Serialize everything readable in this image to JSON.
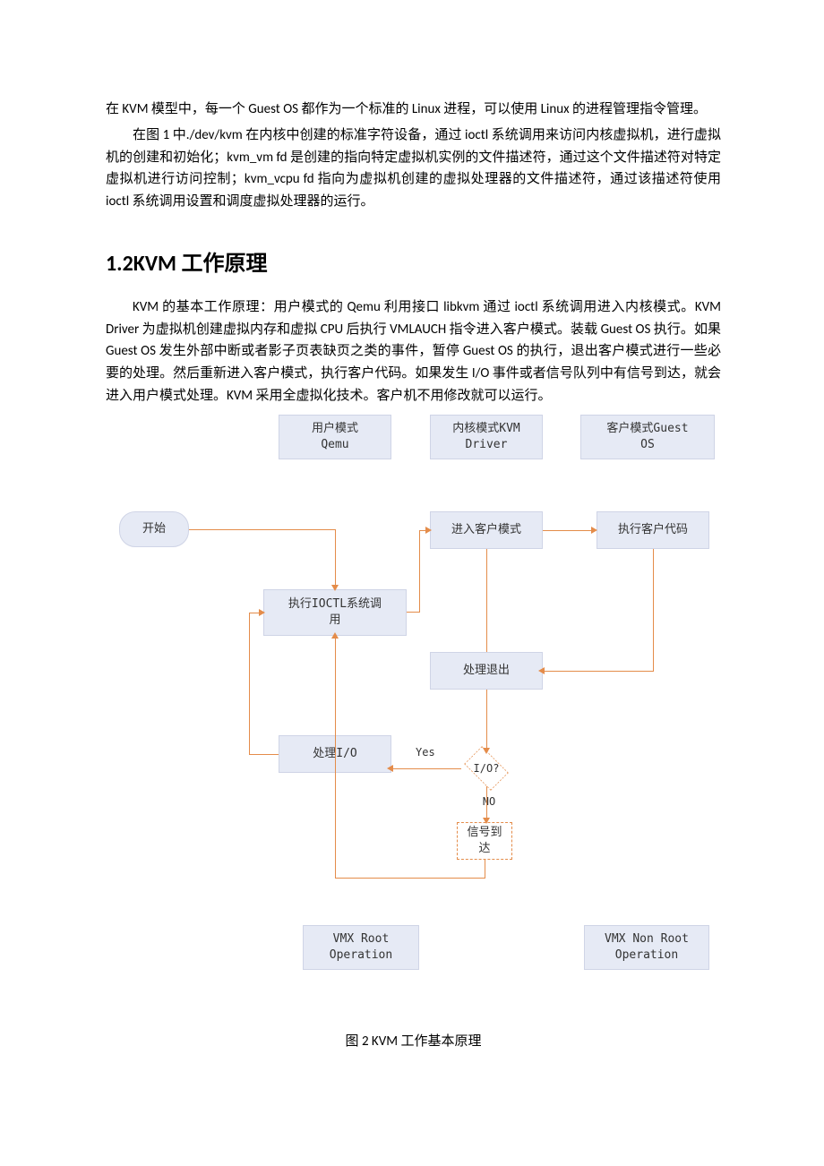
{
  "intro": {
    "p1": "在 KVM 模型中，每一个 Guest OS 都作为一个标准的 Linux 进程，可以使用 Linux 的进程管理指令管理。",
    "p2": "在图 1 中./dev/kvm 在内核中创建的标准字符设备，通过 ioctl 系统调用来访问内核虚拟机，进行虚拟机的创建和初始化；kvm_vm fd 是创建的指向特定虚拟机实例的文件描述符，通过这个文件描述符对特定虚拟机进行访问控制；kvm_vcpu fd 指向为虚拟机创建的虚拟处理器的文件描述符，通过该描述符使用 ioctl 系统调用设置和调度虚拟处理器的运行。"
  },
  "section": {
    "heading": "1.2KVM 工作原理",
    "body": "KVM 的基本工作原理：用户模式的 Qemu 利用接口 libkvm 通过 ioctl 系统调用进入内核模式。KVM Driver 为虚拟机创建虚拟内存和虚拟 CPU 后执行 VMLAUCH 指令进入客户模式。装载 Guest OS 执行。如果 Guest OS 发生外部中断或者影子页表缺页之类的事件，暂停 Guest OS 的执行，退出客户模式进行一些必要的处理。然后重新进入客户模式，执行客户代码。如果发生 I/O 事件或者信号队列中有信号到达，就会进入用户模式处理。KVM 采用全虚拟化技术。客户机不用修改就可以运行。"
  },
  "caption": "图 2 KVM  工作基本原理",
  "chart_data": {
    "type": "flowchart",
    "columns": [
      {
        "id": "start_col",
        "label": ""
      },
      {
        "id": "qemu",
        "label": "用户模式\nQemu"
      },
      {
        "id": "kvm",
        "label": "内核模式KVM\nDriver"
      },
      {
        "id": "guest",
        "label": "客户模式Guest\nOS"
      }
    ],
    "nodes": {
      "start": "开始",
      "ioctl": "执行IOCTL系统调\n用",
      "handle_io": "处理I/O",
      "enter_guest": "进入客户模式",
      "exec_guest": "执行客户代码",
      "handle_exit": "处理退出",
      "io_decision": "I/O?",
      "yes": "Yes",
      "no": "NO",
      "signal": "信号到\n达",
      "vmx_root": "VMX Root\nOperation",
      "vmx_nonroot": "VMX Non Root\nOperation"
    },
    "edges": [
      [
        "start",
        "ioctl"
      ],
      [
        "ioctl",
        "enter_guest"
      ],
      [
        "enter_guest",
        "exec_guest"
      ],
      [
        "exec_guest",
        "handle_exit"
      ],
      [
        "handle_exit",
        "io_decision"
      ],
      [
        "io_decision",
        "handle_io",
        "Yes"
      ],
      [
        "io_decision",
        "signal",
        "NO"
      ],
      [
        "signal",
        "ioctl"
      ],
      [
        "handle_io",
        "ioctl"
      ]
    ],
    "regions": [
      {
        "label": "VMX Root Operation",
        "columns": [
          "qemu",
          "kvm"
        ]
      },
      {
        "label": "VMX Non Root Operation",
        "columns": [
          "guest"
        ]
      }
    ]
  }
}
